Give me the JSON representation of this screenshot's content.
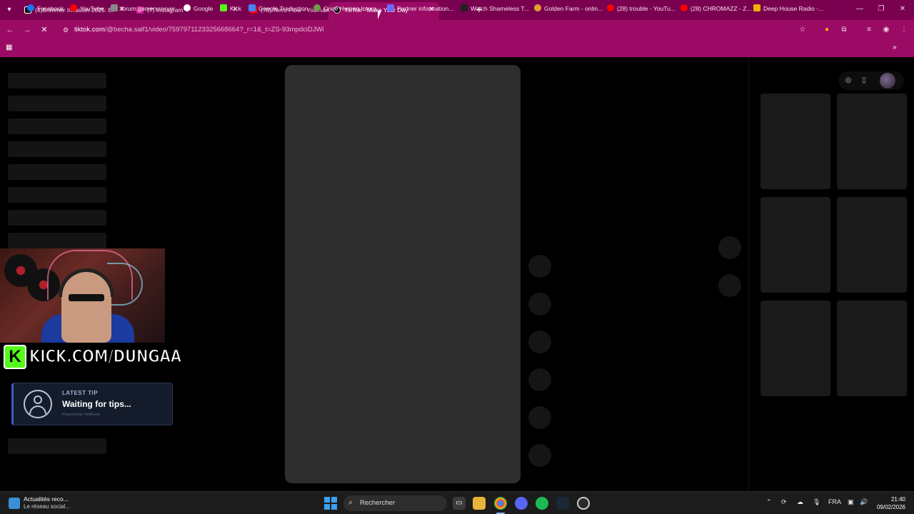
{
  "browser": {
    "tabs": [
      {
        "title": "(4)Brimmer Invasion 2025: BMW",
        "color": "#111111"
      },
      {
        "title": "(7) Instagram",
        "color": "#d6249f"
      },
      {
        "title": "(78) Terro Flow - YouTube",
        "color": "#ff0000"
      },
      {
        "title": "TikTok - Make Your Day",
        "color": "#000000"
      }
    ],
    "url_host": "tiktok.com",
    "url_path": "/@becha.saif1/video/7597971123325668664?_r=1&_t=ZS-93mpdciDJWi",
    "bookmarks": [
      {
        "label": "Facebook",
        "color": "#1877f2"
      },
      {
        "label": "YouTube",
        "color": "#ff0000"
      },
      {
        "label": "forum.gamerxserver...",
        "color": "#888888"
      },
      {
        "label": "Google",
        "color": "#ffffff"
      },
      {
        "label": "Kick",
        "color": "#53fc18"
      },
      {
        "label": "Google Traduction",
        "color": "#4285f4"
      },
      {
        "label": "Once Human Intera...",
        "color": "#6e9c4a"
      },
      {
        "label": "Partner information...",
        "color": "#6a6aff"
      },
      {
        "label": "Watch Shameless T...",
        "color": "#222222"
      },
      {
        "label": "Golden Farm - onlin...",
        "color": "#e0a030"
      },
      {
        "label": "(28) trouble - YouTu...",
        "color": "#ff0000"
      },
      {
        "label": "(28) CHROMAZZ - Z...",
        "color": "#ff0000"
      },
      {
        "label": "Deep House Radio -...",
        "color": "#f0b000"
      }
    ]
  },
  "overlay": {
    "kick_text": "KICK.COM/DUNGAA",
    "kick_letter": "K",
    "tip_label": "LATEST TIP",
    "tip_value": "Waiting for tips...",
    "tip_powered": "Powered by TwitFeed"
  },
  "taskbar": {
    "news_title": "Actualités reco...",
    "news_sub": "Le réseau social...",
    "search_placeholder": "Rechercher",
    "language": "FRA",
    "time": "21:40",
    "date": "09/02/2026"
  }
}
